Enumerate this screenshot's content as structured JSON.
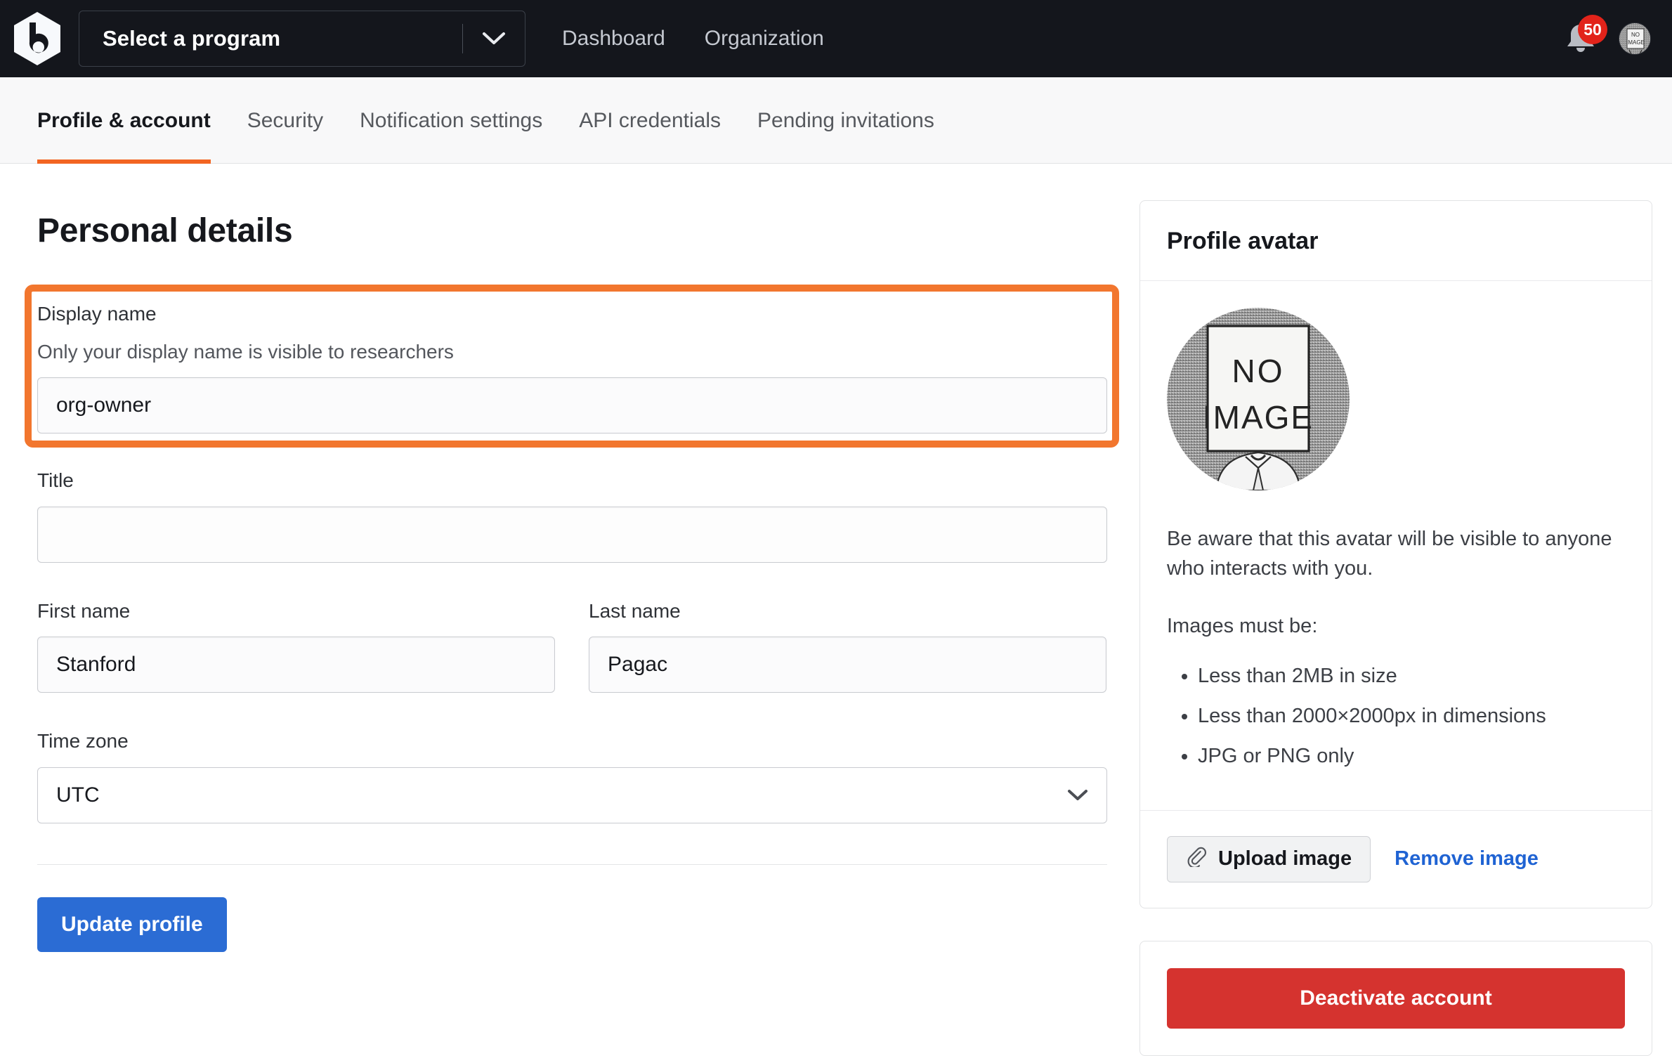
{
  "header": {
    "logo_name": "bugcrowd-logo",
    "program_select_label": "Select a program",
    "nav": [
      {
        "label": "Dashboard"
      },
      {
        "label": "Organization"
      }
    ],
    "notifications_count": "50",
    "avatar_alt": "NO IMAGE"
  },
  "tabs": [
    {
      "label": "Profile & account",
      "active": true
    },
    {
      "label": "Security",
      "active": false
    },
    {
      "label": "Notification settings",
      "active": false
    },
    {
      "label": "API credentials",
      "active": false
    },
    {
      "label": "Pending invitations",
      "active": false
    }
  ],
  "personal_details": {
    "title": "Personal details",
    "display_name": {
      "label": "Display name",
      "hint": "Only your display name is visible to researchers",
      "value": "org-owner",
      "placeholder": ""
    },
    "title_field": {
      "label": "Title",
      "value": "",
      "placeholder": ""
    },
    "first_name": {
      "label": "First name",
      "value": "Stanford",
      "placeholder": ""
    },
    "last_name": {
      "label": "Last name",
      "value": "Pagac",
      "placeholder": ""
    },
    "time_zone": {
      "label": "Time zone",
      "value": "UTC"
    },
    "submit_label": "Update profile"
  },
  "profile_avatar": {
    "card_title": "Profile avatar",
    "avatar_text_line1": "NO",
    "avatar_text_line2": "IMAGE",
    "notice": "Be aware that this avatar will be visible to anyone who interacts with you.",
    "requirements_title": "Images must be:",
    "requirements": [
      "Less than 2MB in size",
      "Less than 2000×2000px in dimensions",
      "JPG or PNG only"
    ],
    "upload_label": "Upload image",
    "remove_label": "Remove image"
  },
  "danger_zone": {
    "deactivate_label": "Deactivate account"
  },
  "colors": {
    "accent_orange": "#f2762e",
    "primary_blue": "#2b6cd4",
    "danger_red": "#d5332f",
    "badge_red": "#e2231a",
    "topbar_dark": "#14161c",
    "link_blue": "#1f63d3"
  }
}
